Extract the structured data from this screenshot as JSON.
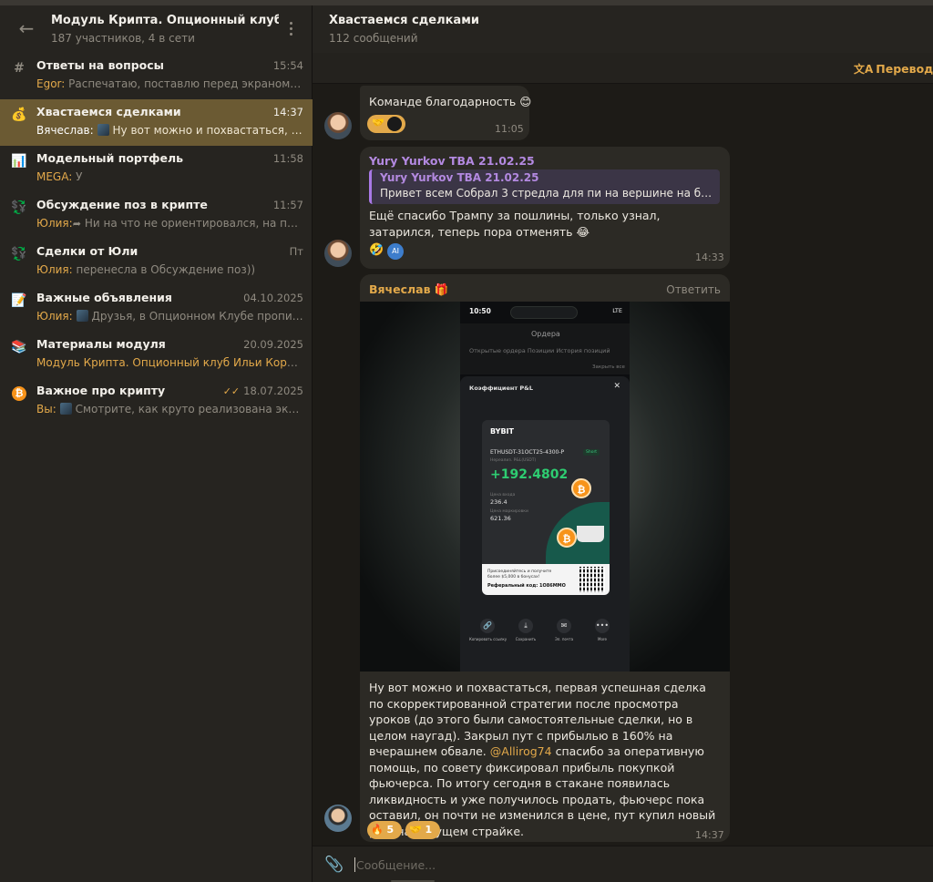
{
  "group": {
    "title": "Модуль Крипта. Опционный клуб Ил...",
    "subtitle": "187 участников, 4 в сети"
  },
  "topics": [
    {
      "icon": "#",
      "name": "Ответы на вопросы",
      "time": "15:54",
      "sender": "Egor:",
      "preview": "Распечатаю, поставлю перед экраном, оче..."
    },
    {
      "icon": "💰",
      "name": "Хвастаемся сделками",
      "time": "14:37",
      "sender": "Вячеслав:",
      "preview": "Ну вот можно и похвастаться, пер..."
    },
    {
      "icon": "📊",
      "name": "Модельный портфель",
      "time": "11:58",
      "sender": "MEGA:",
      "preview": "У"
    },
    {
      "icon": "💱",
      "name": "Обсуждение поз в крипте",
      "time": "11:57",
      "sender": "Юлия:",
      "preview": "Ни на что не ориентировался, на проб..."
    },
    {
      "icon": "💱",
      "name": "Сделки от Юли",
      "time": "Пт",
      "sender": "Юлия:",
      "preview": "перенесла в Обсуждение поз))"
    },
    {
      "icon": "📝",
      "name": "Важные объявления",
      "time": "04.10.2025",
      "sender": "Юлия:",
      "preview": "Друзья, в Опционном Клубе прописа..."
    },
    {
      "icon": "📚",
      "name": "Материалы модуля",
      "time": "20.09.2025",
      "sender": "Модуль Крипта. Опционный клуб Ильи Корови...",
      "preview": ""
    },
    {
      "icon": "₿",
      "name": "Важное про крипту",
      "time": "18.07.2025",
      "sender": "Вы:",
      "preview": "Смотрите, как круто реализована экспи..."
    }
  ],
  "chat": {
    "title": "Хвастаемся сделками",
    "subtitle": "112 сообщений",
    "translate_label": "Перевод (а"
  },
  "messages": {
    "m1": {
      "text": "Команде благодарность 😊",
      "time": "11:05"
    },
    "m2": {
      "author": "Yury Yurkov TBA 21.02.25",
      "quote_author": "Yury Yurkov TBA 21.02.25",
      "quote_text": "Привет  всем Собрал 3 стредла для пи на вершине на битке, э...",
      "text": "Ещё спасибо Трампу за пошлины, только узнал, затарился, теперь пора отменять 😂",
      "ai_badge": "AI",
      "time": "14:33"
    },
    "m3": {
      "author": "Вячеслав",
      "reply_label": "Ответить",
      "text_before": "Ну вот можно и похвастаться, первая успешная сделка по скорректированной стратегии после просмотра уроков (до этого были самостоятельные сделки, но в целом наугад). Закрыл пут с прибылью в 160% на вчерашнем обвале. ",
      "mention": "@Allirog74",
      "text_after": " спасибо за оперативную помощь, по совету фиксировал прибыль покупкой фьючерса. По итогу сегодня в стакане появилась ликвидность и уже получилось продать, фьючерс пока оставил, он почти не изменился в цене, пут купил новый уже на текущем страйке.",
      "reaction_fire": "🔥 5",
      "reaction_hand": "🤝 1",
      "time": "14:37"
    }
  },
  "screenshot": {
    "status_time": "10:50",
    "network": "LTE",
    "title": "Ордера",
    "tabs": "Открытые ордера   Позиции   История позиций",
    "close_all": "Закрыть все",
    "sheet_title": "Коэффициент P&L",
    "close_x": "✕",
    "logo": "BYBIT",
    "symbol": "ETHUSDT-31OCT25-4300-P",
    "tag": "Short",
    "pnl_label": "Нереализ. P&L(USDT)",
    "pnl": "+192.4802",
    "entry_label": "Цена входа",
    "entry": "236.4",
    "mark_label": "Цена маркировки",
    "mark": "621.36",
    "promo": "Присоединяйтесь и получите более $5,000 в бонусах!",
    "ref": "Реферальный код: 1O86MMO",
    "actions": [
      "Копировать ссылку",
      "Сохранить",
      "Эл. почта",
      "More"
    ]
  },
  "input": {
    "placeholder": "Сообщение..."
  }
}
